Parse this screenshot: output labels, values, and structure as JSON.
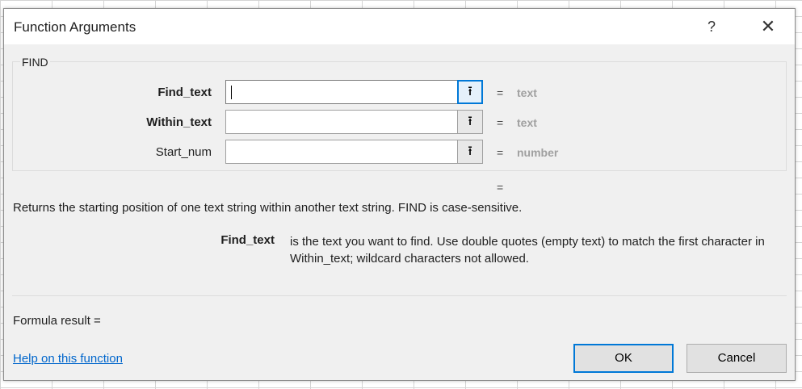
{
  "dialog": {
    "title": "Function Arguments",
    "help_glyph": "?",
    "close_glyph": "✕"
  },
  "function": {
    "name": "FIND",
    "args": [
      {
        "label": "Find_text",
        "value": "",
        "equals": "=",
        "hint": "text",
        "bold": true
      },
      {
        "label": "Within_text",
        "value": "",
        "equals": "=",
        "hint": "text",
        "bold": true
      },
      {
        "label": "Start_num",
        "value": "",
        "equals": "=",
        "hint": "number",
        "bold": false
      }
    ],
    "collapse_glyph": "⭱",
    "result_equals": "=",
    "description": "Returns the starting position of one text string within another text string. FIND is case-sensitive.",
    "arg_desc_name": "Find_text",
    "arg_desc_text": "is the text you want to find. Use double quotes (empty text) to match the first character in Within_text; wildcard characters not allowed."
  },
  "footer": {
    "formula_result": "Formula result =",
    "help_link": "Help on this function",
    "ok_label": "OK",
    "cancel_label": "Cancel"
  },
  "colors": {
    "accent": "#0078d7",
    "link": "#0066cc",
    "hint": "#a0a0a0",
    "dialog_bg": "#f0f0f0"
  }
}
